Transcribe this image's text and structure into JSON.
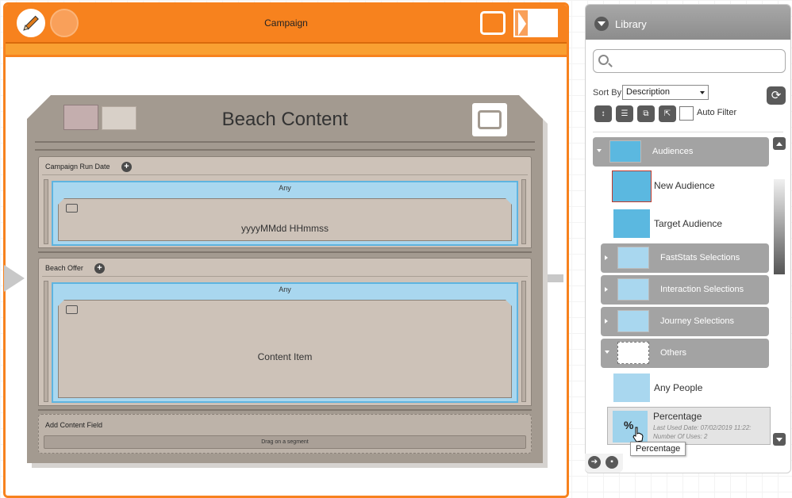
{
  "campaign": {
    "title": "Campaign"
  },
  "card": {
    "title": "Beach Content",
    "sections": [
      {
        "label": "Campaign Run Date",
        "any": "Any",
        "content": "yyyyMMdd HHmmss"
      },
      {
        "label": "Beach Offer",
        "any": "Any",
        "content": "Content Item"
      }
    ],
    "add_field": {
      "label": "Add Content Field",
      "drag_text": "Drag on a segment"
    }
  },
  "library": {
    "title": "Library",
    "search": {
      "value": "",
      "placeholder": ""
    },
    "sort_by_label": "Sort By",
    "sort_value": "Description",
    "auto_filter_label": "Auto Filter",
    "groups": {
      "audiences": "Audiences",
      "faststats": "FastStats Selections",
      "interaction": "Interaction Selections",
      "journey": "Journey Selections",
      "others": "Others"
    },
    "items": {
      "new_audience": "New Audience",
      "target_audience": "Target Audience",
      "any_people": "Any People",
      "percentage": {
        "name": "Percentage",
        "symbol": "%",
        "last_used": "Last Used Date: 07/02/2019 11:22:",
        "uses": "Number Of Uses: 2"
      }
    },
    "tooltip": "Percentage"
  },
  "colors": {
    "accent": "#f7821e",
    "card": "#a39a90",
    "highlight": "#a9d7ef",
    "audience": "#5bb8e0"
  }
}
